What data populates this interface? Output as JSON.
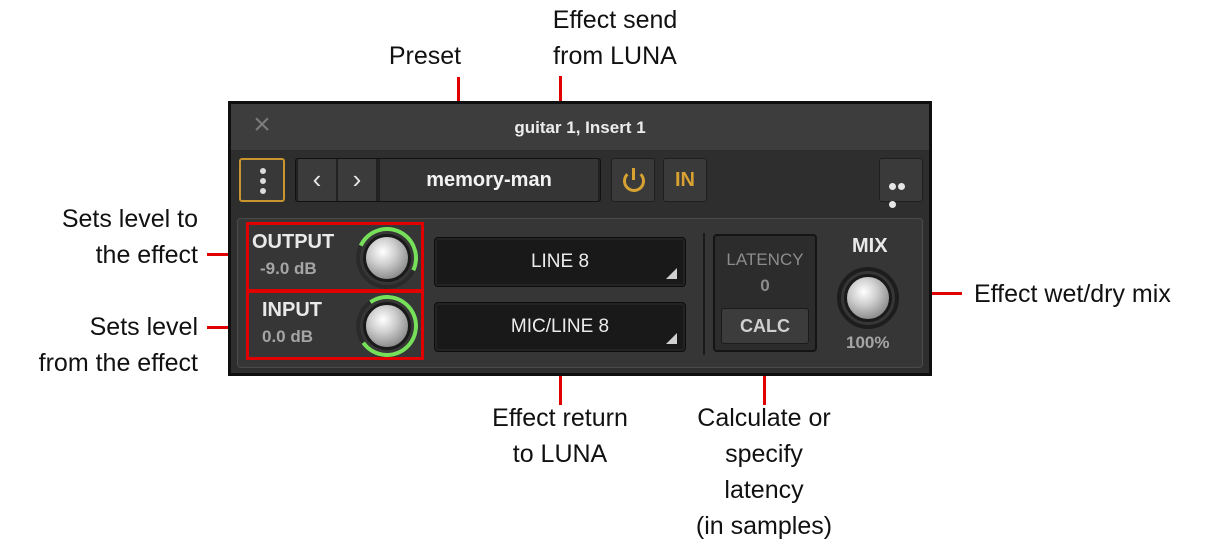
{
  "callouts": {
    "preset": "Preset",
    "effect_send_line1": "Effect send",
    "effect_send_line2": "from LUNA",
    "sets_level_to_line1": "Sets level to",
    "sets_level_to_line2": "the effect",
    "sets_level_from_line1": "Sets level",
    "sets_level_from_line2": "from the effect",
    "effect_return_line1": "Effect return",
    "effect_return_line2": "to LUNA",
    "latency_line1": "Calculate or",
    "latency_line2": "specify",
    "latency_line3": "latency",
    "latency_line4": "(in samples)",
    "wet_dry": "Effect wet/dry mix"
  },
  "window": {
    "title": "guitar 1, Insert 1",
    "close_icon": "close-icon"
  },
  "toolbar": {
    "preset_name": "memory-man",
    "prev_icon": "‹",
    "next_icon": "›",
    "in_label": "IN",
    "accent_color": "#d7a232"
  },
  "controls": {
    "output_label": "OUTPUT",
    "output_value": "-9.0 dB",
    "input_label": "INPUT",
    "input_value": "0.0 dB",
    "send_routing": "LINE 8",
    "return_routing": "MIC/LINE 8",
    "latency_label": "LATENCY",
    "latency_value": "0",
    "calc_label": "CALC",
    "mix_label": "MIX",
    "mix_value": "100%"
  },
  "colors": {
    "highlight": "#e00000",
    "knob_ring": "#77e05a"
  }
}
